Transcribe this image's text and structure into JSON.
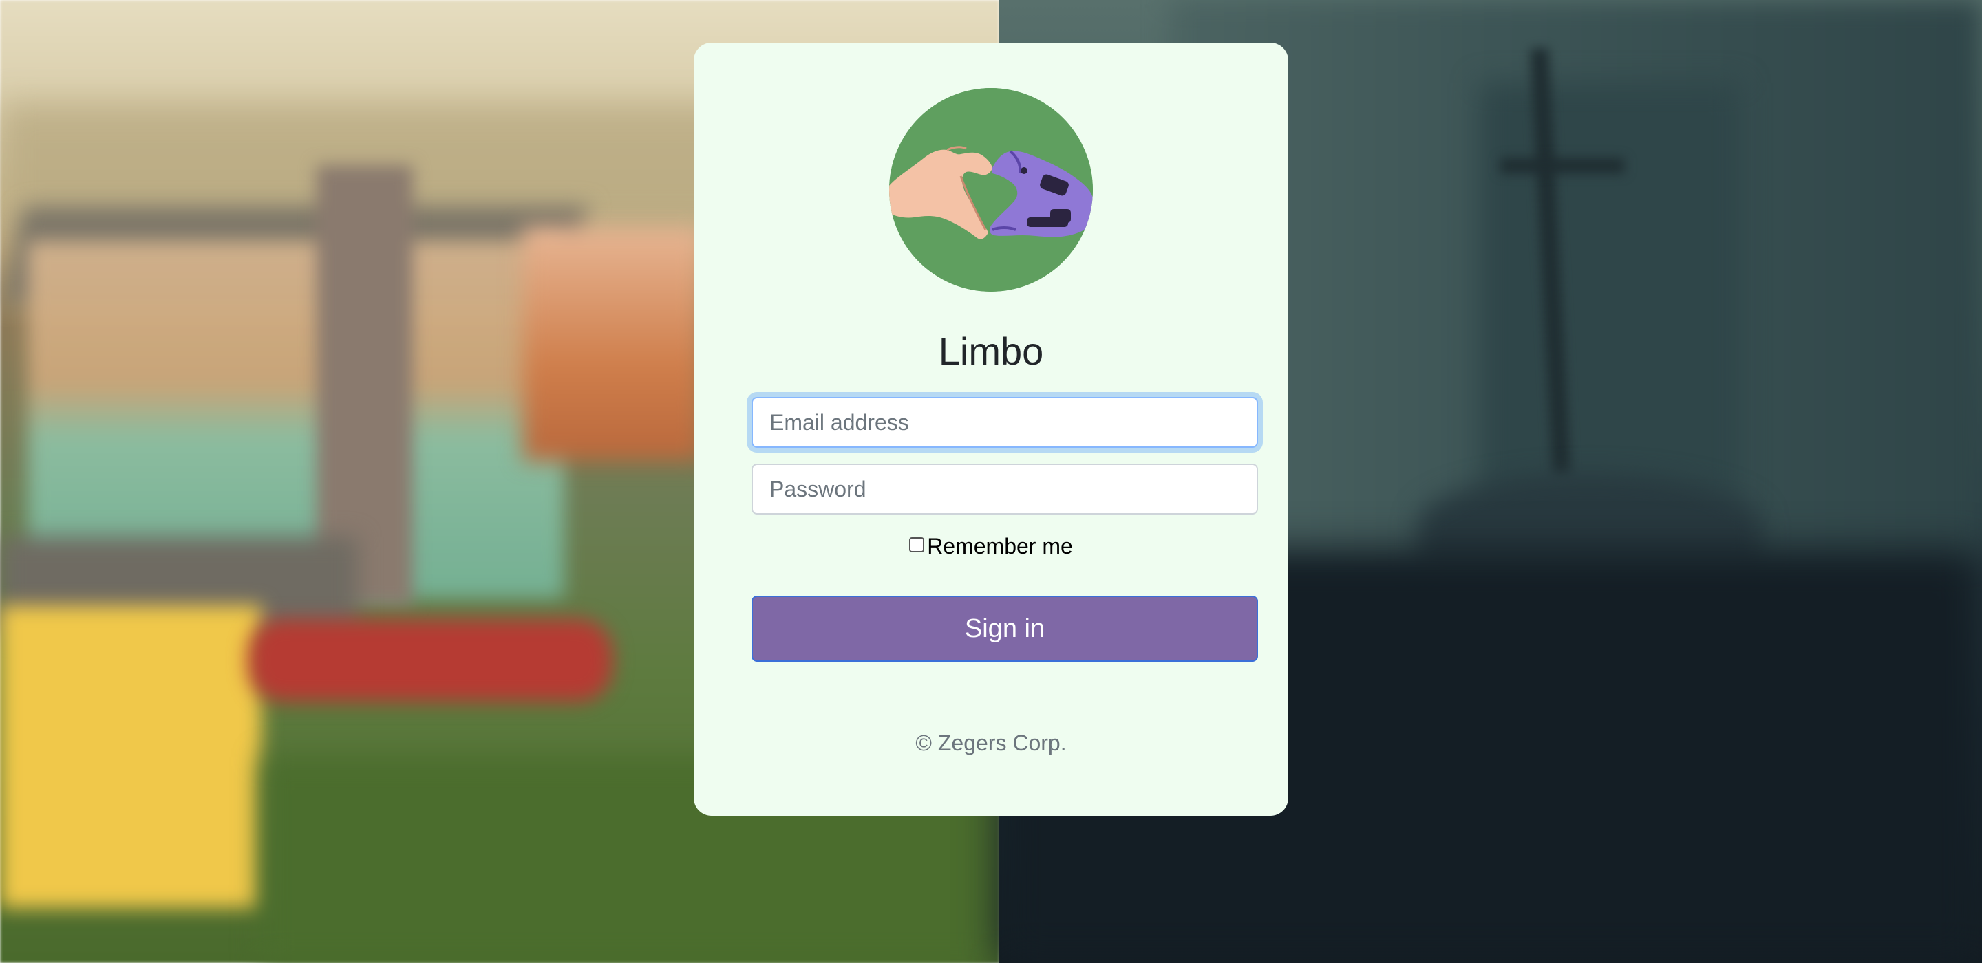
{
  "app": {
    "title": "Limbo"
  },
  "logo": {
    "icon": "heart-hands-icon",
    "background_color": "#5f9f5f"
  },
  "form": {
    "email_placeholder": "Email address",
    "email_value": "",
    "password_placeholder": "Password",
    "password_value": "",
    "remember_label": "Remember me",
    "remember_checked": false,
    "submit_label": "Sign in"
  },
  "footer": {
    "copyright": "© Zegers Corp."
  },
  "colors": {
    "card_background": "#effdf0",
    "button_background": "#7f68a6",
    "focus_ring": "#86b7fe",
    "title_text": "#212529",
    "footer_text": "#6c757d"
  }
}
